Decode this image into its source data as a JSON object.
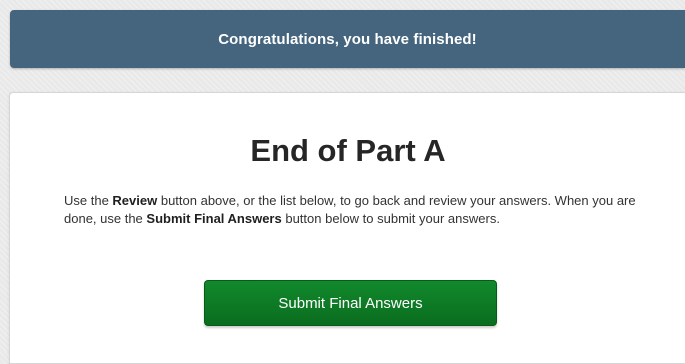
{
  "banner": {
    "message": "Congratulations, you have finished!"
  },
  "main": {
    "title": "End of Part A",
    "instructions": {
      "part1": "Use the ",
      "review_word": "Review",
      "part2": " button above, or the list below, to go back and review your answers. When you are done, use the ",
      "submit_word": "Submit Final Answers",
      "part3": " button below to submit your answers."
    },
    "submit_button_label": "Submit Final Answers"
  },
  "colors": {
    "banner_bg": "#44657d",
    "submit_green": "#0f8229",
    "page_bg": "#e9e9e9"
  }
}
